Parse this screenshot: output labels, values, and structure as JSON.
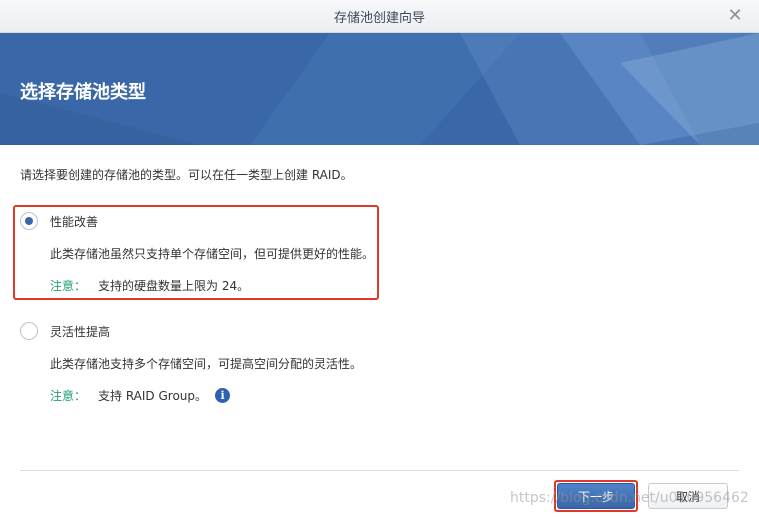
{
  "window": {
    "title": "存储池创建向导"
  },
  "banner": {
    "heading": "选择存储池类型"
  },
  "intro": "请选择要创建的存储池的类型。可以在任一类型上创建 RAID。",
  "options": [
    {
      "label": "性能改善",
      "selected": true,
      "description": "此类存储池虽然只支持单个存储空间，但可提供更好的性能。",
      "note_label": "注意：",
      "note_text": "支持的硬盘数量上限为 24。"
    },
    {
      "label": "灵活性提高",
      "selected": false,
      "description": "此类存储池支持多个存储空间，可提高空间分配的灵活性。",
      "note_label": "注意：",
      "note_text": "支持 RAID Group。"
    }
  ],
  "footer": {
    "next_label": "下一步",
    "cancel_label": "取消"
  },
  "watermark": "https://blog.csdn.net/u010956462",
  "colors": {
    "accent": "#3a67a7",
    "note": "#1f9d7a",
    "highlight": "#e0392b"
  },
  "icons": {
    "close": "close-icon",
    "info": "info-icon"
  }
}
